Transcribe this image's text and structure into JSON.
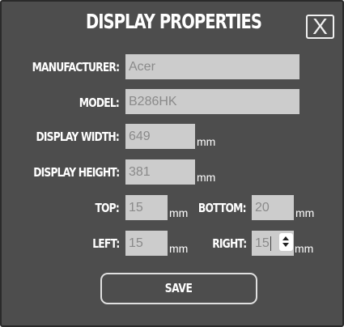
{
  "dialog": {
    "title": "DISPLAY PROPERTIES",
    "close_label": "X",
    "save_label": "SAVE"
  },
  "fields": {
    "manufacturer": {
      "label": "MANUFACTURER:",
      "value": "Acer"
    },
    "model": {
      "label": "MODEL:",
      "value": "B286HK"
    },
    "display_width": {
      "label": "DISPLAY WIDTH:",
      "value": "649",
      "unit": "mm"
    },
    "display_height": {
      "label": "DISPLAY HEIGHT:",
      "value": "381",
      "unit": "mm"
    },
    "top": {
      "label": "TOP:",
      "value": "15",
      "unit": "mm"
    },
    "bottom": {
      "label": "BOTTOM:",
      "value": "20",
      "unit": "mm"
    },
    "left": {
      "label": "LEFT:",
      "value": "15",
      "unit": "mm"
    },
    "right": {
      "label": "RIGHT:",
      "value": "15",
      "unit": "mm"
    }
  },
  "colors": {
    "dialog_background": "#4d4d4d",
    "field_background": "#cccccc",
    "field_text": "#8a8a8a",
    "label_text": "#ffffff"
  },
  "icons": {
    "close": "close-icon",
    "spinner": "spinner-arrows-icon"
  }
}
